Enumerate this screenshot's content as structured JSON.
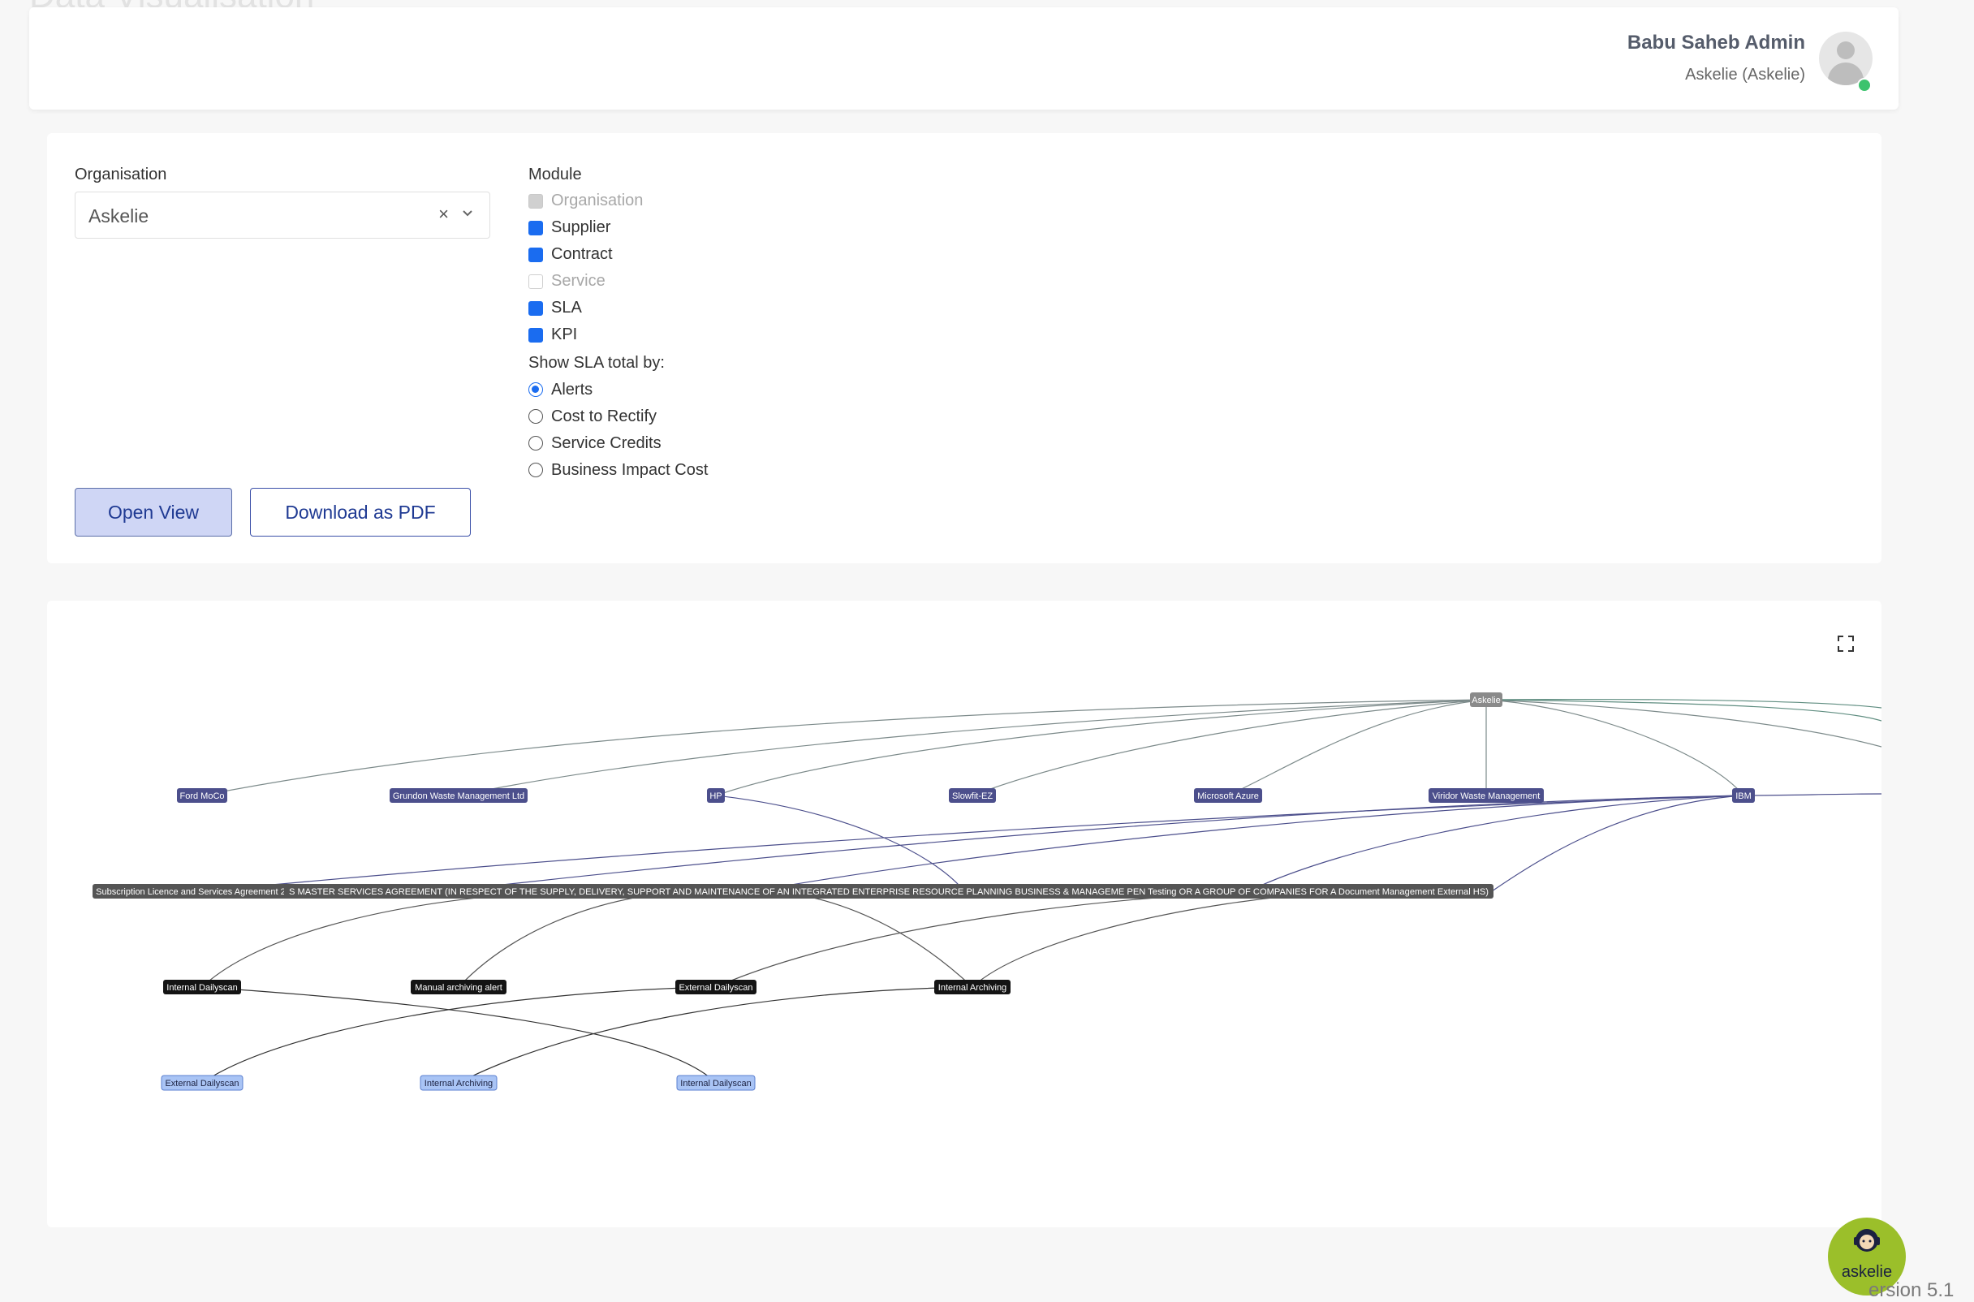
{
  "page": {
    "title_ghost": "Data Visualisation",
    "version_ghost": "ersion 5.1"
  },
  "header": {
    "user_name": "Babu Saheb Admin",
    "user_org": "Askelie (Askelie)",
    "avatar_icon": "user-avatar-icon",
    "status_color": "#3cc36d"
  },
  "filters": {
    "organisation_label": "Organisation",
    "organisation_value": "Askelie",
    "module_label": "Module",
    "modules": [
      {
        "label": "Organisation",
        "checked": true,
        "disabled": true
      },
      {
        "label": "Supplier",
        "checked": true,
        "disabled": false
      },
      {
        "label": "Contract",
        "checked": true,
        "disabled": false
      },
      {
        "label": "Service",
        "checked": false,
        "disabled": true
      },
      {
        "label": "SLA",
        "checked": true,
        "disabled": false
      },
      {
        "label": "KPI",
        "checked": true,
        "disabled": false
      }
    ],
    "sla_total_label": "Show SLA total by:",
    "sla_total_options": [
      {
        "label": "Alerts",
        "selected": true
      },
      {
        "label": "Cost to Rectify",
        "selected": false
      },
      {
        "label": "Service Credits",
        "selected": false
      },
      {
        "label": "Business Impact Cost",
        "selected": false
      }
    ],
    "open_view_label": "Open View",
    "download_pdf_label": "Download as PDF"
  },
  "graph": {
    "fullscreen_icon": "fullscreen-icon",
    "colors": {
      "organisation": "#8a8a8a",
      "supplier": "#4c4f8c",
      "contract": "#555555",
      "sla": "#141414",
      "kpi": "#a9c4f5"
    },
    "nodes": {
      "askelie": "Askelie",
      "ford": "Ford MoCo",
      "grundon": "Grundon Waste Management Ltd",
      "hp": "HP",
      "slowfit": "Slowfit-EZ",
      "azure": "Microsoft Azure",
      "viridor": "Viridor Waste Management",
      "ibm": "IBM",
      "contract_sub": "Subscription Licence and Services Agreement 24 Feb",
      "contract_master": "S MASTER SERVICES AGREEMENT (IN RESPECT OF THE SUPPLY, DELIVERY, SUPPORT AND MAINTENANCE OF AN INTEGRATED ENTERPRISE RESOURCE PLANNING BUSINESS & MANAGEME PEN Testing  OR A GROUP OF COMPANIES FOR A  Document Management External  HS)",
      "sla_internal_dailyscan": "Internal Dailyscan",
      "sla_manual_archiving": "Manual archiving alert",
      "sla_external_dailyscan": "External Dailyscan",
      "sla_internal_archiving": "Internal Archiving",
      "kpi_external_dailyscan": "External Dailyscan",
      "kpi_internal_archiving": "Internal Archiving",
      "kpi_internal_dailyscan": "Internal Dailyscan"
    }
  },
  "chatbot": {
    "label": "askelie",
    "color": "#9bbf2a"
  }
}
